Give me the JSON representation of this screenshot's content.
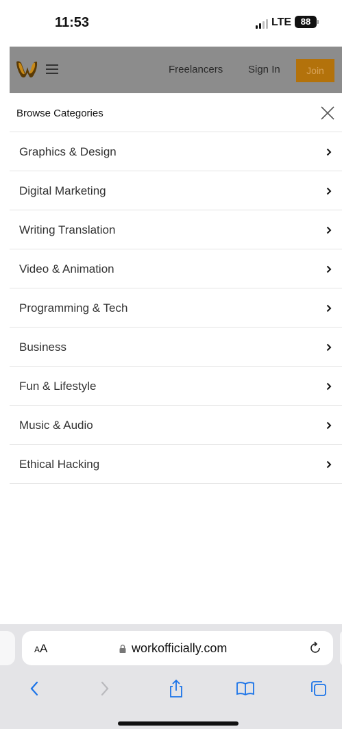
{
  "status_bar": {
    "time": "11:53",
    "network": "LTE",
    "battery": "88"
  },
  "site_header": {
    "logo_icon": "workofficially-logo-icon",
    "menu_icon": "hamburger-icon",
    "nav": {
      "freelancers": "Freelancers",
      "sign_in": "Sign In",
      "join": "Join"
    }
  },
  "panel": {
    "title": "Browse Categories",
    "close_icon": "close-icon",
    "categories": [
      {
        "label": "Graphics & Design"
      },
      {
        "label": "Digital Marketing"
      },
      {
        "label": "Writing Translation"
      },
      {
        "label": "Video & Animation"
      },
      {
        "label": "Programming & Tech"
      },
      {
        "label": "Business"
      },
      {
        "label": "Fun & Lifestyle"
      },
      {
        "label": "Music & Audio"
      },
      {
        "label": "Ethical Hacking"
      }
    ]
  },
  "safari": {
    "aa_label_small": "A",
    "aa_label_large": "A",
    "url": "workofficially.com",
    "toolbar_icons": [
      "back-icon",
      "forward-icon",
      "share-icon",
      "bookmarks-icon",
      "tabs-icon"
    ]
  },
  "colors": {
    "accent_blue": "#1a73e8",
    "join_button": "#b3720b",
    "dim_overlay": "#8c8c8c"
  }
}
